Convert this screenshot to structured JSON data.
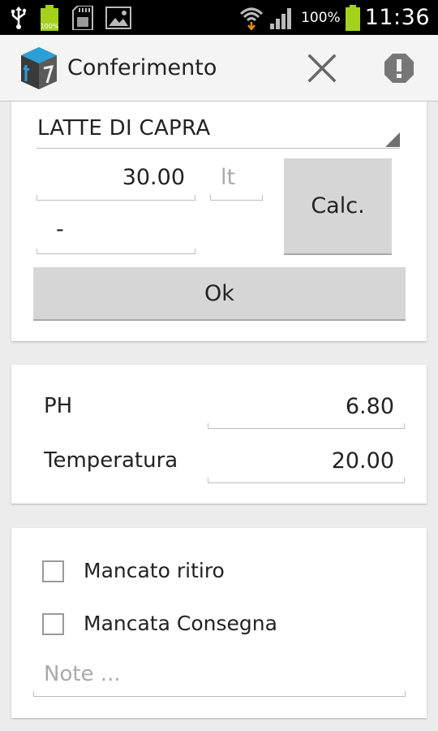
{
  "status_bar": {
    "battery_percent": "100%",
    "time": "11:36",
    "icons": [
      "usb-icon",
      "battery-small-icon",
      "sd-card-icon",
      "image-icon",
      "wifi-icon",
      "signal-icon",
      "battery-icon"
    ]
  },
  "action_bar": {
    "title": "Conferimento",
    "close_icon": "close-icon",
    "alert_icon": "alert-icon"
  },
  "form": {
    "product": "LATTE DI CAPRA",
    "quantity": "30.00",
    "unit": "lt",
    "secondary_value": "-",
    "calc_button": "Calc.",
    "ok_button": "Ok"
  },
  "measurements": {
    "ph_label": "PH",
    "ph_value": "6.80",
    "temperature_label": "Temperatura",
    "temperature_value": "20.00"
  },
  "options": {
    "missed_pickup_label": "Mancato ritiro",
    "missed_pickup_checked": false,
    "missed_delivery_label": "Mancata Consegna",
    "missed_delivery_checked": false,
    "notes_placeholder": "Note ..."
  },
  "colors": {
    "status_bar": "#000000",
    "battery": "#a4d21c",
    "background": "#ececec",
    "button": "#d6d6d6"
  }
}
